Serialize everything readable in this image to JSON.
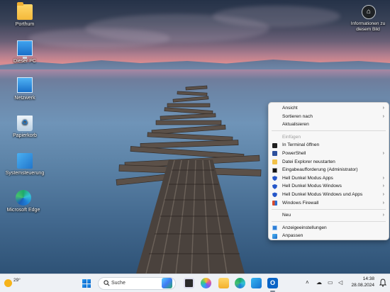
{
  "desktop_icons": [
    {
      "label": "Porthum"
    },
    {
      "label": "Dieser PC"
    },
    {
      "label": "Netzwerk"
    },
    {
      "label": "Papierkorb"
    },
    {
      "label": "Systemsteuerung"
    },
    {
      "label": "Microsoft Edge"
    }
  ],
  "info_widget": {
    "label": "Informationen zu diesem Bild"
  },
  "context_menu": {
    "view": "Ansicht",
    "sort_by": "Sortieren nach",
    "refresh": "Aktualisieren",
    "paste": "Einfügen",
    "open_terminal": "In Terminal öffnen",
    "powershell": "PowerShell",
    "restart_explorer": "Datei Explorer neustarten",
    "cmd_admin": "Eingabeaufforderung (Administrator)",
    "dark_apps": "Hell Dunkel Modus Apps",
    "dark_windows": "Hell Dunkel Modus Windows",
    "dark_windows_apps": "Hell Dunkel Modus Windows und Apps",
    "firewall": "Windows Firewall",
    "new": "Neu",
    "display_settings": "Anzeigeeinstellungen",
    "personalize": "Anpassen",
    "submenu_arrow": "›"
  },
  "taskbar": {
    "weather_temp": "29°",
    "search_placeholder": "Suche",
    "outlook_letter": "O",
    "time": "14:38",
    "date": "28.08.2024"
  },
  "colors": {
    "accent": "#0b63c8",
    "menu_bg": "#f7f7f7",
    "taskbar_bg": "#eef1f5"
  }
}
